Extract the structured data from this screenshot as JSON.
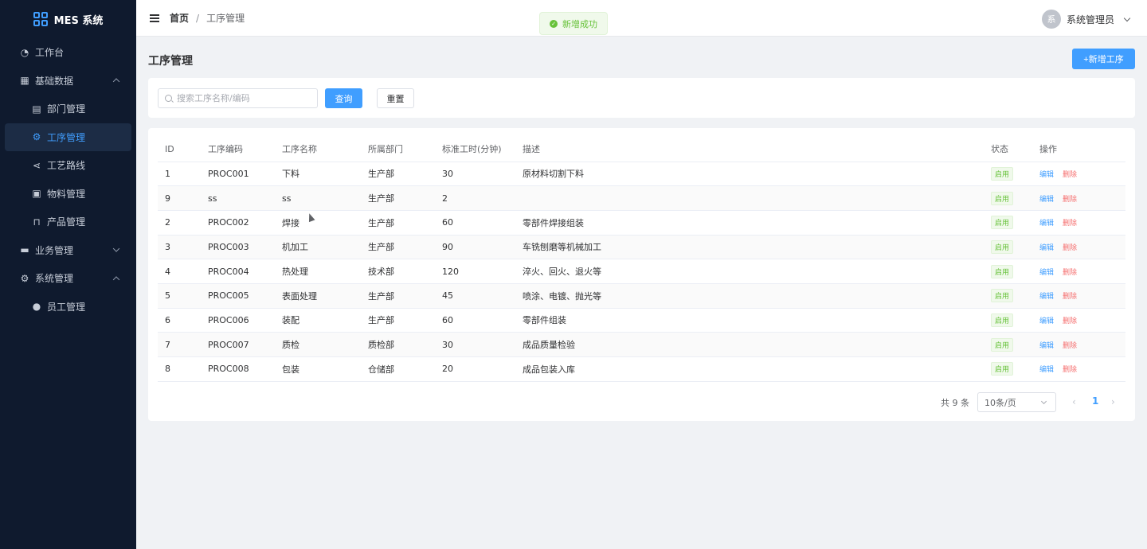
{
  "app": {
    "title": "MES 系统"
  },
  "sidebar": {
    "items": [
      {
        "label": "工作台",
        "icon": "dashboard-icon"
      },
      {
        "label": "基础数据",
        "icon": "grid-icon",
        "expanded": true
      },
      {
        "label": "部门管理",
        "icon": "building-icon",
        "sub": true
      },
      {
        "label": "工序管理",
        "icon": "gear-icon",
        "sub": true,
        "active": true
      },
      {
        "label": "工艺路线",
        "icon": "share-icon",
        "sub": true
      },
      {
        "label": "物料管理",
        "icon": "package-icon",
        "sub": true
      },
      {
        "label": "产品管理",
        "icon": "bag-icon",
        "sub": true
      },
      {
        "label": "业务管理",
        "icon": "briefcase-icon",
        "expanded": false
      },
      {
        "label": "系统管理",
        "icon": "settings-icon",
        "expanded": true
      },
      {
        "label": "员工管理",
        "icon": "user-icon",
        "sub": true
      }
    ]
  },
  "header": {
    "breadcrumb_home": "首页",
    "breadcrumb_sep": "/",
    "breadcrumb_current": "工序管理",
    "avatar_text": "系",
    "user_name": "系统管理员"
  },
  "toast": {
    "message": "新增成功",
    "color": "#67c23a"
  },
  "page": {
    "title": "工序管理",
    "add_label": "+新增工序"
  },
  "search": {
    "placeholder": "搜索工序名称/编码",
    "value": "",
    "query_label": "查询",
    "reset_label": "重置"
  },
  "table": {
    "columns": [
      "ID",
      "工序编码",
      "工序名称",
      "所属部门",
      "标准工时(分钟)",
      "描述",
      "状态",
      "操作"
    ],
    "rows": [
      {
        "id": "1",
        "code": "PROC001",
        "name": "下料",
        "dept": "生产部",
        "time": "30",
        "desc": "原材料切割下料",
        "status": "启用"
      },
      {
        "id": "9",
        "code": "ss",
        "name": "ss",
        "dept": "生产部",
        "time": "2",
        "desc": "",
        "status": "启用"
      },
      {
        "id": "2",
        "code": "PROC002",
        "name": "焊接",
        "dept": "生产部",
        "time": "60",
        "desc": "零部件焊接组装",
        "status": "启用"
      },
      {
        "id": "3",
        "code": "PROC003",
        "name": "机加工",
        "dept": "生产部",
        "time": "90",
        "desc": "车铣刨磨等机械加工",
        "status": "启用"
      },
      {
        "id": "4",
        "code": "PROC004",
        "name": "热处理",
        "dept": "技术部",
        "time": "120",
        "desc": "淬火、回火、退火等",
        "status": "启用"
      },
      {
        "id": "5",
        "code": "PROC005",
        "name": "表面处理",
        "dept": "生产部",
        "time": "45",
        "desc": "喷涂、电镀、抛光等",
        "status": "启用"
      },
      {
        "id": "6",
        "code": "PROC006",
        "name": "装配",
        "dept": "生产部",
        "time": "60",
        "desc": "零部件组装",
        "status": "启用"
      },
      {
        "id": "7",
        "code": "PROC007",
        "name": "质检",
        "dept": "质检部",
        "time": "30",
        "desc": "成品质量检验",
        "status": "启用"
      },
      {
        "id": "8",
        "code": "PROC008",
        "name": "包装",
        "dept": "仓储部",
        "time": "20",
        "desc": "成品包装入库",
        "status": "启用"
      }
    ],
    "edit_label": "编辑",
    "delete_label": "删除"
  },
  "pagination": {
    "total_label": "共 9 条",
    "page_size": "10条/页",
    "current_page": "1",
    "prev": "‹",
    "next": "›"
  }
}
